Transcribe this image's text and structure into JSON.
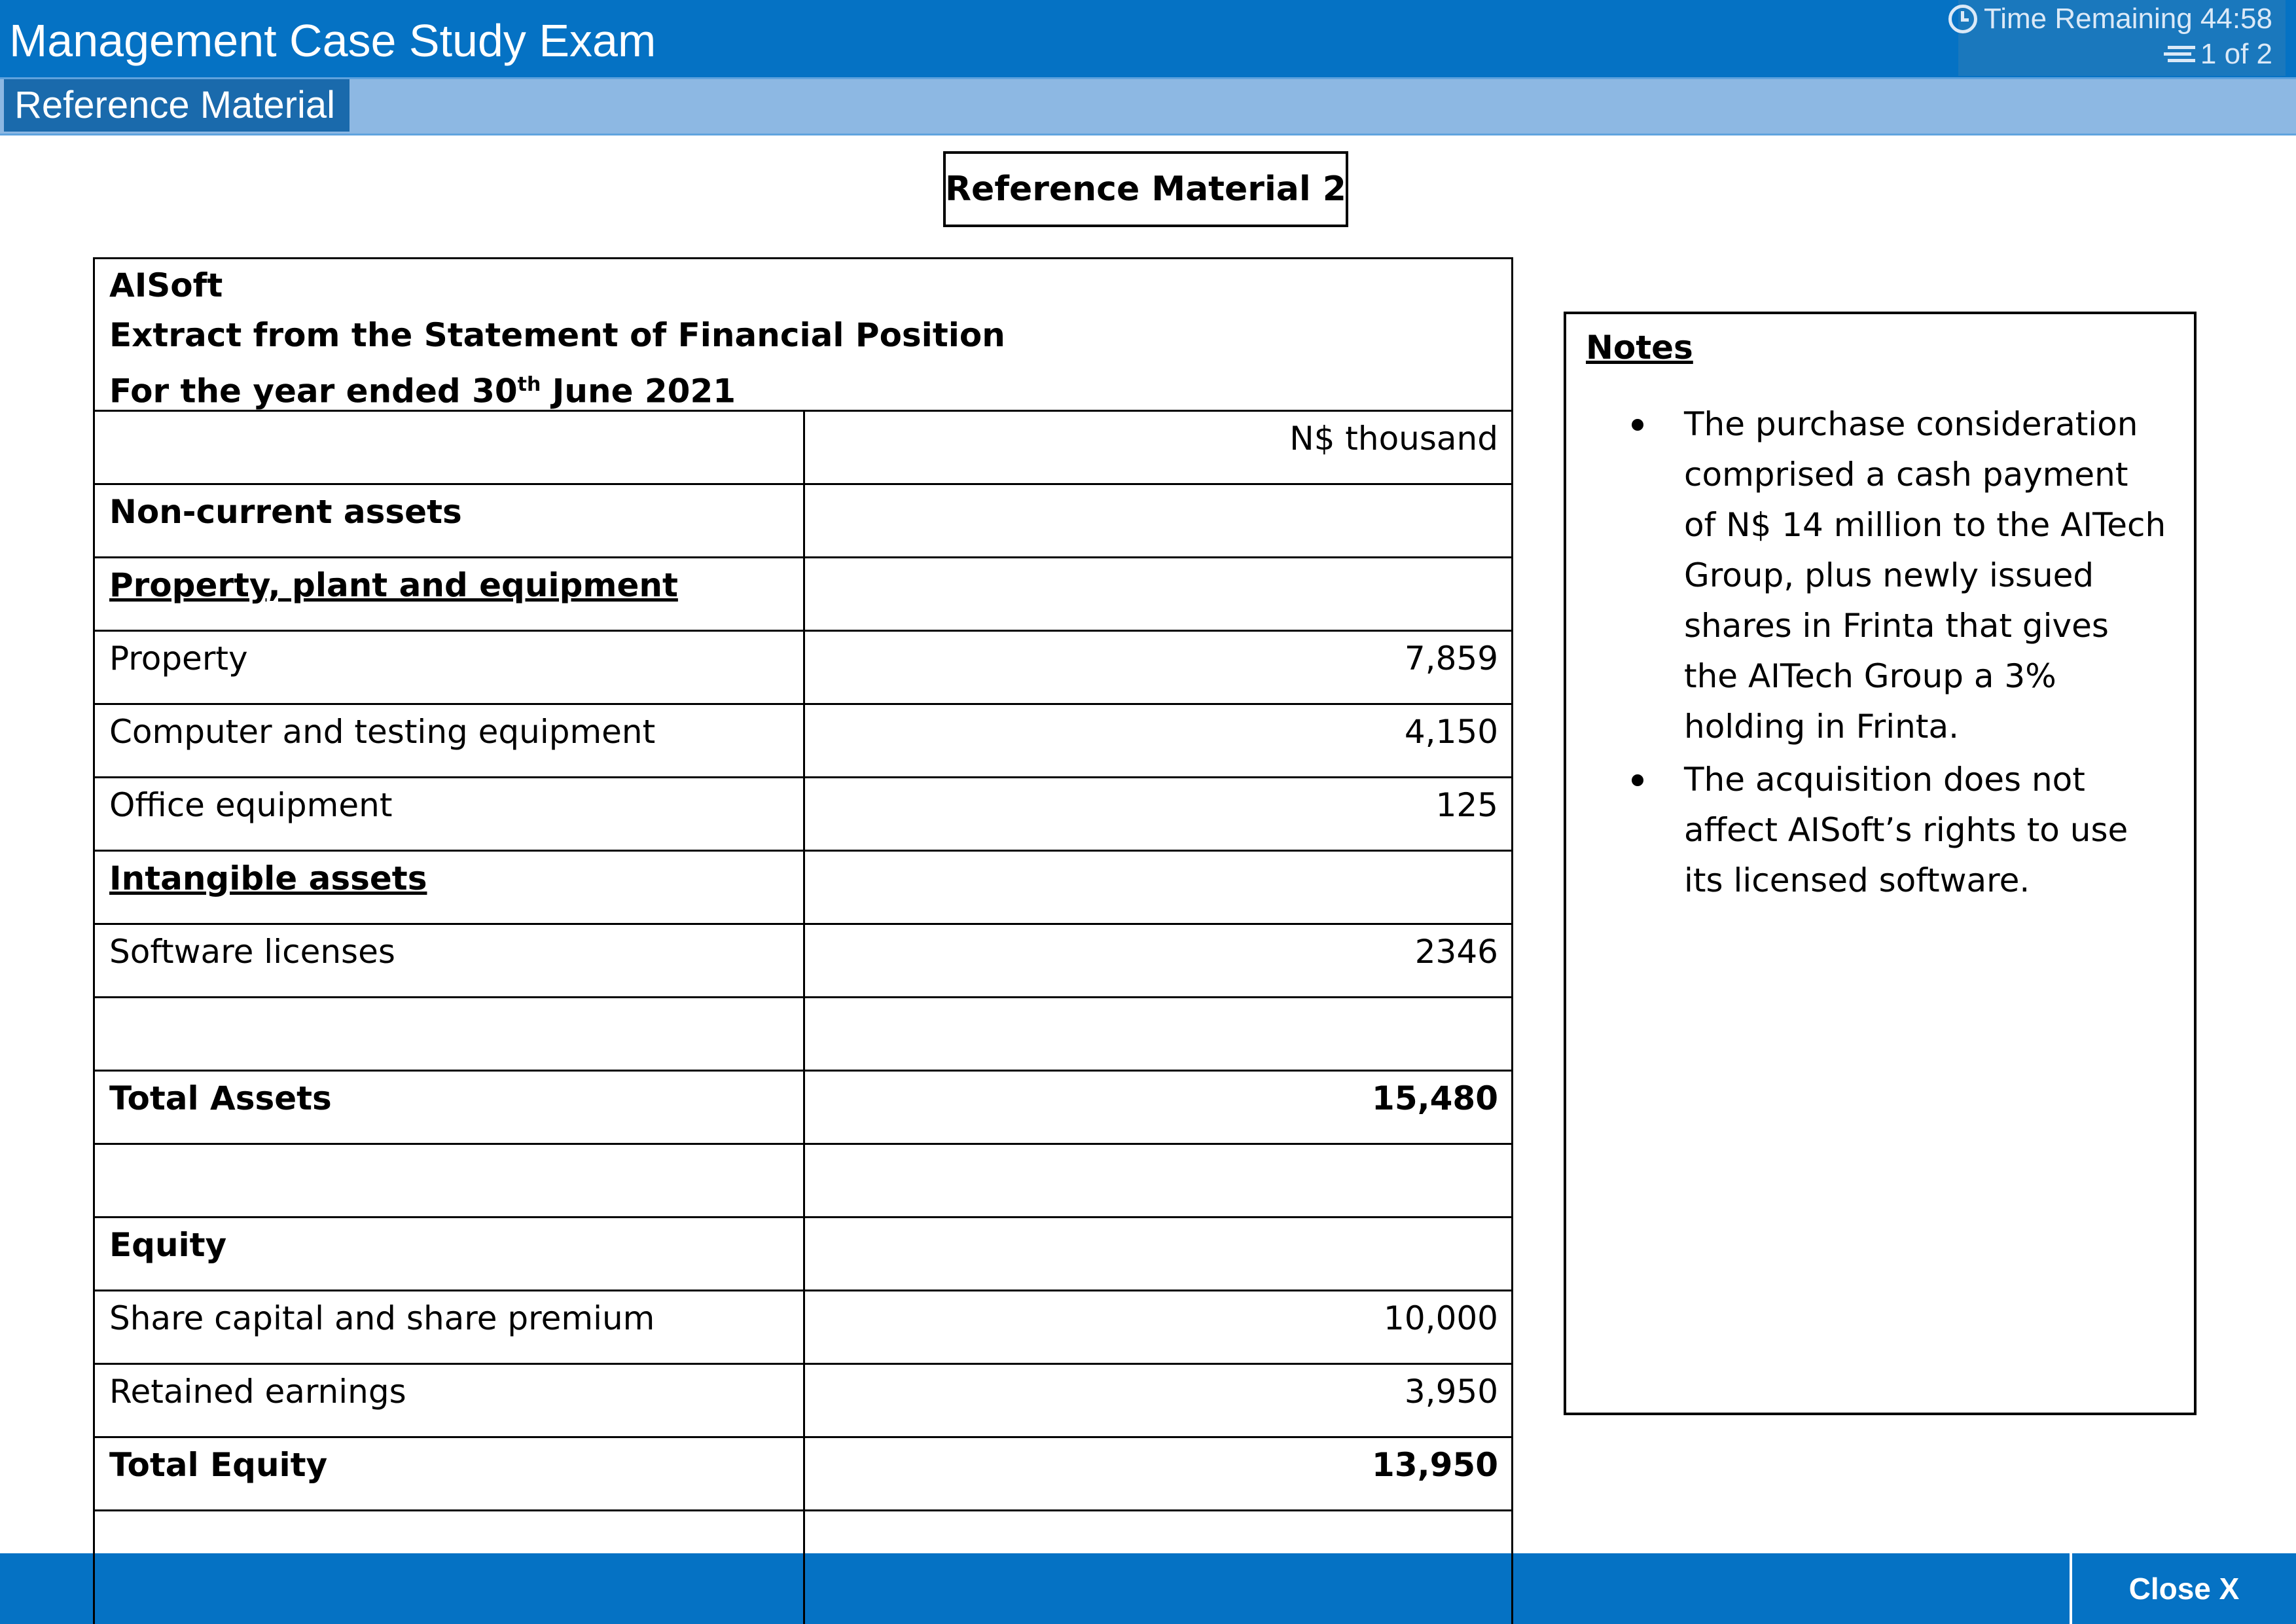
{
  "header": {
    "title": "Management Case Study Exam",
    "time_remaining": "Time Remaining 44:58",
    "page_indicator": "1 of 2"
  },
  "tabs": {
    "active_label": "Reference Material"
  },
  "reference": {
    "heading": "Reference Material 2"
  },
  "statement": {
    "company": "AISoft",
    "title": "Extract from the Statement of Financial Position",
    "period_prefix": "For the year ended 30",
    "period_sup": "th",
    "period_suffix": " June 2021",
    "unit": "N$ thousand",
    "rows": [
      {
        "label": "Non-current assets",
        "value": ""
      },
      {
        "label": "Property, plant and equipment",
        "value": ""
      },
      {
        "label": "Property",
        "value": "7,859"
      },
      {
        "label": "Computer and testing equipment",
        "value": "4,150"
      },
      {
        "label": "Office equipment",
        "value": "125"
      },
      {
        "label": "Intangible assets",
        "value": ""
      },
      {
        "label": "Software licenses",
        "value": "2346"
      },
      {
        "label": "",
        "value": ""
      },
      {
        "label": "Total Assets",
        "value": "15,480"
      },
      {
        "label": "",
        "value": ""
      },
      {
        "label": "Equity",
        "value": ""
      },
      {
        "label": "Share capital and share premium",
        "value": "10,000"
      },
      {
        "label": "Retained earnings",
        "value": "3,950"
      },
      {
        "label": "Total Equity",
        "value": "13,950"
      },
      {
        "label": "",
        "value": ""
      }
    ]
  },
  "notes": {
    "title": "Notes",
    "items": [
      "The purchase consideration comprised a cash payment of N$ 14 million to the AITech Group, plus newly issued shares in Frinta that gives the AITech Group a 3% holding in Frinta.",
      "The acquisition does not affect AISoft’s rights to use its licensed software."
    ]
  },
  "footer": {
    "close_label": "Close X"
  },
  "colors": {
    "header_blue": "#0572c4",
    "tab_bar": "#8db8e3",
    "active_tab": "#1a6aac"
  }
}
